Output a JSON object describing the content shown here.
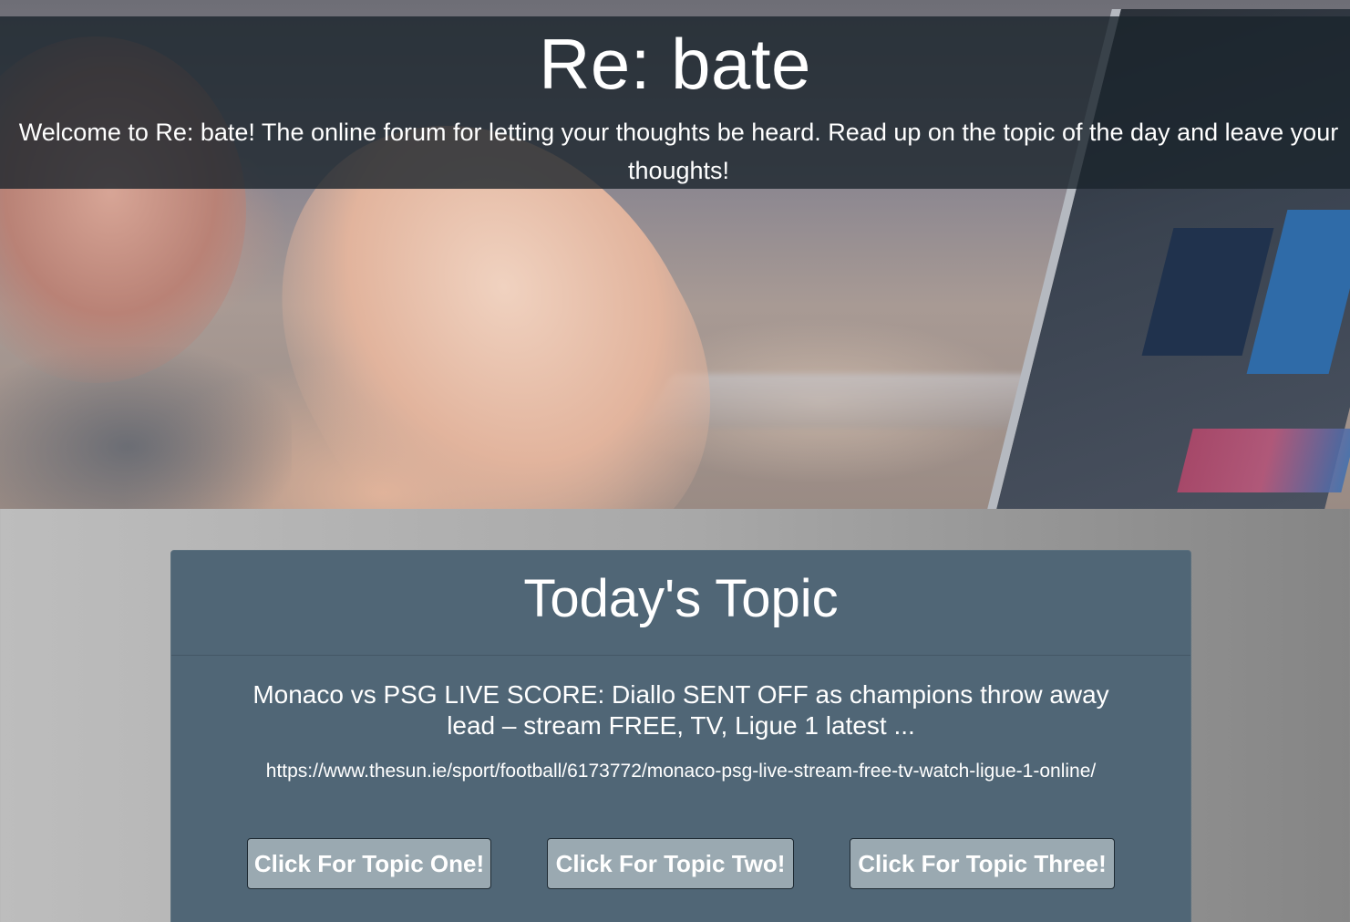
{
  "header": {
    "title": "Re: bate",
    "welcome": "Welcome to Re: bate! The online forum for letting your thoughts be heard. Read up on the topic of the day and leave your thoughts!"
  },
  "topic_card": {
    "heading": "Today's Topic",
    "headline": "Monaco vs PSG LIVE SCORE: Diallo SENT OFF as champions throw away lead – stream FREE, TV, Ligue 1 latest ...",
    "url": "https://www.thesun.ie/sport/football/6173772/monaco-psg-live-stream-free-tv-watch-ligue-1-online/",
    "buttons": [
      {
        "label": "Click For Topic One!"
      },
      {
        "label": "Click For Topic Two!"
      },
      {
        "label": "Click For Topic Three!"
      }
    ]
  },
  "colors": {
    "banner_overlay": "#1a242c",
    "card_background": "#506676",
    "button_background": "#9aa9b1",
    "page_gradient_left": "#bdbdbd",
    "page_gradient_right": "#858585"
  }
}
